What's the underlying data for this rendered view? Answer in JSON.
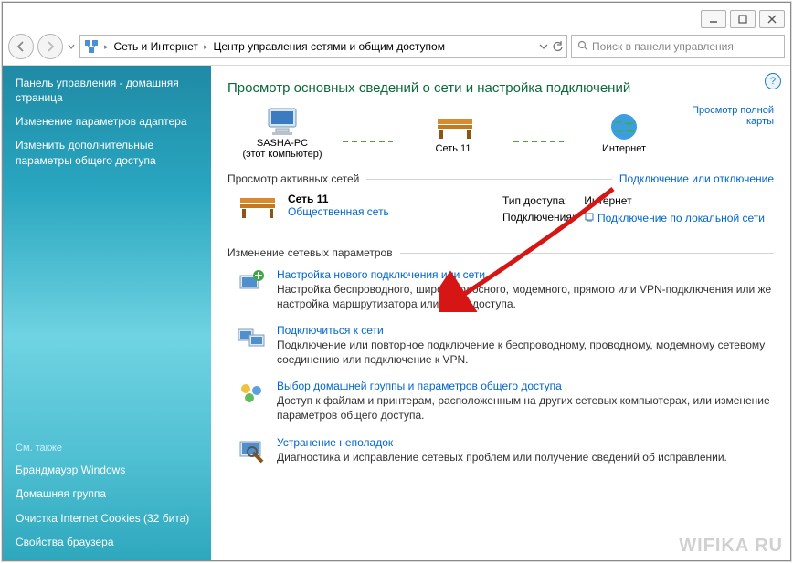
{
  "breadcrumb": {
    "item1": "Сеть и Интернет",
    "item2": "Центр управления сетями и общим доступом"
  },
  "search": {
    "placeholder": "Поиск в панели управления"
  },
  "sidebar": {
    "title": "Панель управления - домашняя страница",
    "link1": "Изменение параметров адаптера",
    "link2": "Изменить дополнительные параметры общего доступа",
    "see_also": "См. также",
    "firewall": "Брандмауэр Windows",
    "homegroup": "Домашняя группа",
    "cookies": "Очистка Internet Cookies (32 бита)",
    "browser": "Свойства браузера"
  },
  "page": {
    "title": "Просмотр основных сведений о сети и настройка подключений",
    "full_map": "Просмотр полной карты",
    "map": {
      "pc_name": "SASHA-PC",
      "pc_sub": "(этот компьютер)",
      "network": "Сеть  11",
      "internet": "Интернет"
    },
    "active_header": "Просмотр активных сетей",
    "active_link": "Подключение или отключение",
    "net_name": "Сеть  11",
    "net_type": "Общественная сеть",
    "access_label": "Тип доступа:",
    "access_value": "Интернет",
    "conn_label": "Подключения:",
    "conn_value": "Подключение по локальной сети",
    "settings_header": "Изменение сетевых параметров",
    "items": [
      {
        "title": "Настройка нового подключения или сети",
        "desc": "Настройка беспроводного, широкополосного, модемного, прямого или VPN-подключения или же настройка маршрутизатора или точки доступа."
      },
      {
        "title": "Подключиться к сети",
        "desc": "Подключение или повторное подключение к беспроводному, проводному, модемному сетевому соединению или подключение к VPN."
      },
      {
        "title": "Выбор домашней группы и параметров общего доступа",
        "desc": "Доступ к файлам и принтерам, расположенным на других сетевых компьютерах, или изменение параметров общего доступа."
      },
      {
        "title": "Устранение неполадок",
        "desc": "Диагностика и исправление сетевых проблем или получение сведений об исправлении."
      }
    ]
  },
  "watermark": "WIFIKA RU"
}
